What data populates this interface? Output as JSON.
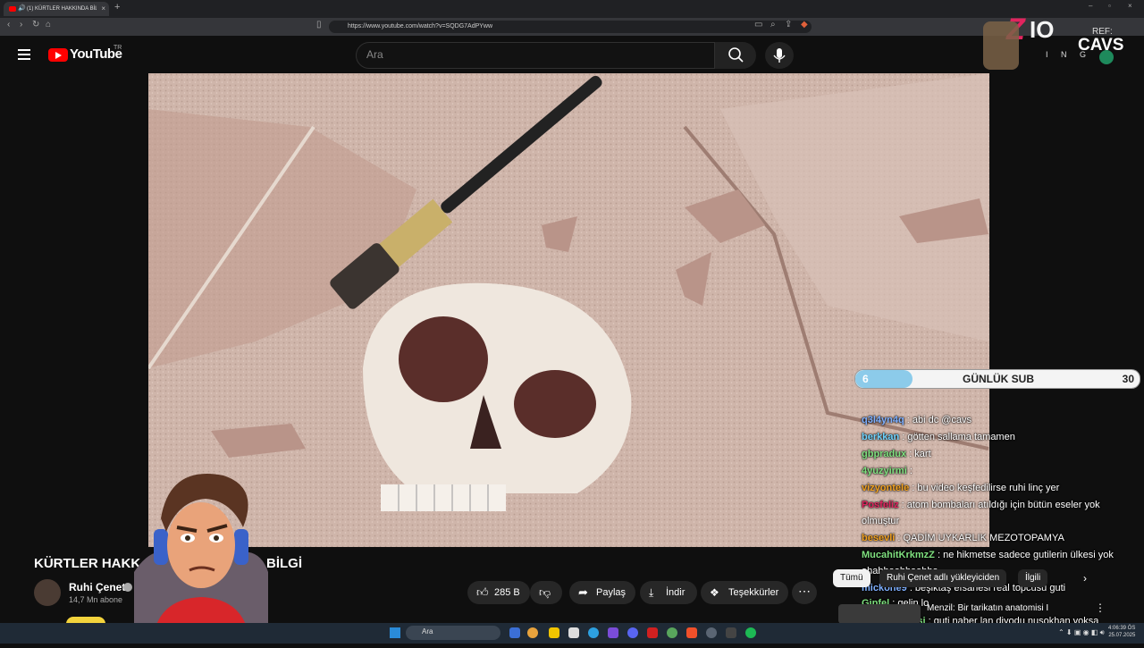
{
  "browser": {
    "tab_title": "(1) KÜRTLER HAKKINDA BİLGİ",
    "tab_close": "×",
    "new_tab": "+",
    "url": "https://www.youtube.com/watch?v=SQDG7AdPYww",
    "win_min": "–",
    "win_max": "▫",
    "win_close": "×"
  },
  "youtube": {
    "logo_text": "YouTube",
    "country": "TR",
    "search_placeholder": "Ara"
  },
  "overlay": {
    "brand_z": "Z",
    "brand_io": "IO",
    "brand_ref": "REF:",
    "brand_cavs": "CAVS",
    "brand_ing": "I N G",
    "sub_current": "6",
    "sub_label": "GÜNLÜK SUB",
    "sub_goal": "30",
    "sub_progress": 0.2
  },
  "chat": [
    {
      "user": "q3l4yn4q",
      "color": "#7fb0ff",
      "message": ": abi dc @cavs"
    },
    {
      "user": "berkkan",
      "color": "#6fd4ff",
      "message": ": götten sallama tamamen"
    },
    {
      "user": "gbpradux",
      "color": "#7fe07f",
      "message": ": kart"
    },
    {
      "user": "4yuzyirmi",
      "color": "#7fe07f",
      "message": ":"
    },
    {
      "user": "vizyontele",
      "color": "#f0a020",
      "message": ": bu video keşfedilirse ruhi linç yer"
    },
    {
      "user": "Posfeliz",
      "color": "#e0245e",
      "message": ": atom bombaları atıldığı için bütün eseler yok olmuştur"
    },
    {
      "user": "besevli",
      "color": "#f0a020",
      "message": ": QADİM UYKARLIK MEZOTOPAMYA"
    },
    {
      "user": "MucahitKrkmzZ",
      "color": "#7fe07f",
      "message": ": ne hikmetse sadece gutilerin ülkesi yok ahahhaahhaahha,"
    },
    {
      "user": "mickone9",
      "color": "#7fb0ff",
      "message": ": beşiktaş efsanesi real topcusu guti"
    },
    {
      "user": "Gipfel",
      "color": "#7fe07f",
      "message": ": gelin lo"
    },
    {
      "user": "thresh_ustasi",
      "color": "#7fe07f",
      "message": ": guti naber lan diyodu nusokhan yoksa"
    }
  ],
  "video": {
    "title_left": "KÜRTLER HAKK",
    "title_right": "BİLGİ",
    "channel": "Ruhi Çenet",
    "subscribers": "14,7 Mn abone",
    "likes": "285 B",
    "share": "Paylaş",
    "download": "İndir",
    "thanks": "Teşekkürler",
    "more": "⋯"
  },
  "related_tabs": [
    "Tümü",
    "Ruhi Çenet adlı yükleyiciden",
    "İlgili"
  ],
  "related": {
    "title": "Menzil: Bir tarikatın anatomisi I"
  },
  "taskbar": {
    "search": "Ara",
    "time": "4:06:39 ÖS",
    "date": "25.07.2025"
  },
  "colors": {
    "yt_red": "#ff0000",
    "sub_fill": "#8ccbea",
    "brand_pink": "#e0245e"
  }
}
